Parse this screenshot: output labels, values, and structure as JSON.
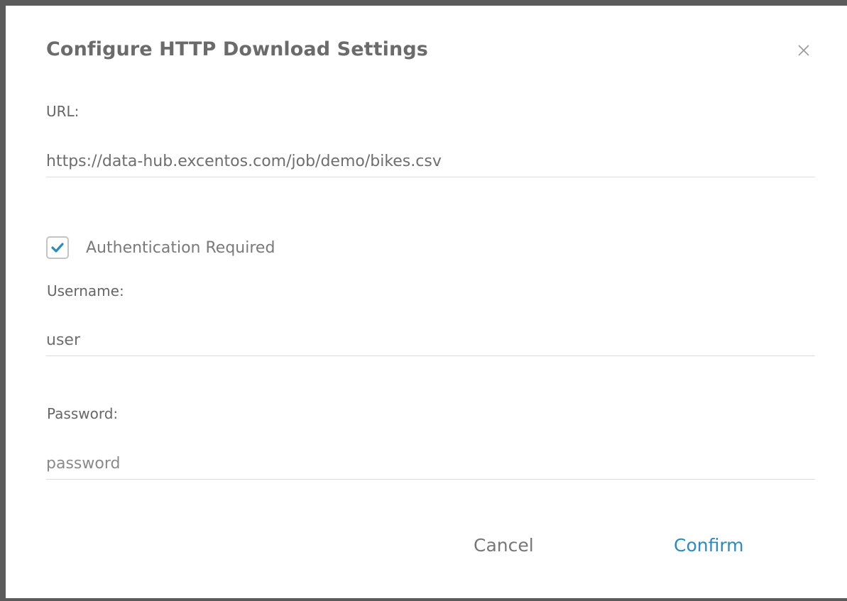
{
  "dialog": {
    "title": "Configure HTTP Download Settings",
    "close_icon": "close-icon"
  },
  "url": {
    "label": "URL:",
    "value": "https://data-hub.excentos.com/job/demo/bikes.csv"
  },
  "auth": {
    "checkbox_label": "Authentication Required",
    "checked": true,
    "check_icon": "checkmark-icon"
  },
  "username": {
    "label": "Username:",
    "value": "user"
  },
  "password": {
    "label": "Password:",
    "placeholder": "password"
  },
  "actions": {
    "cancel_label": "Cancel",
    "confirm_label": "Confirm"
  },
  "colors": {
    "accent": "#2b8bc1",
    "checkmark": "#2b8bc1",
    "backdrop": "#5b5b5b"
  }
}
